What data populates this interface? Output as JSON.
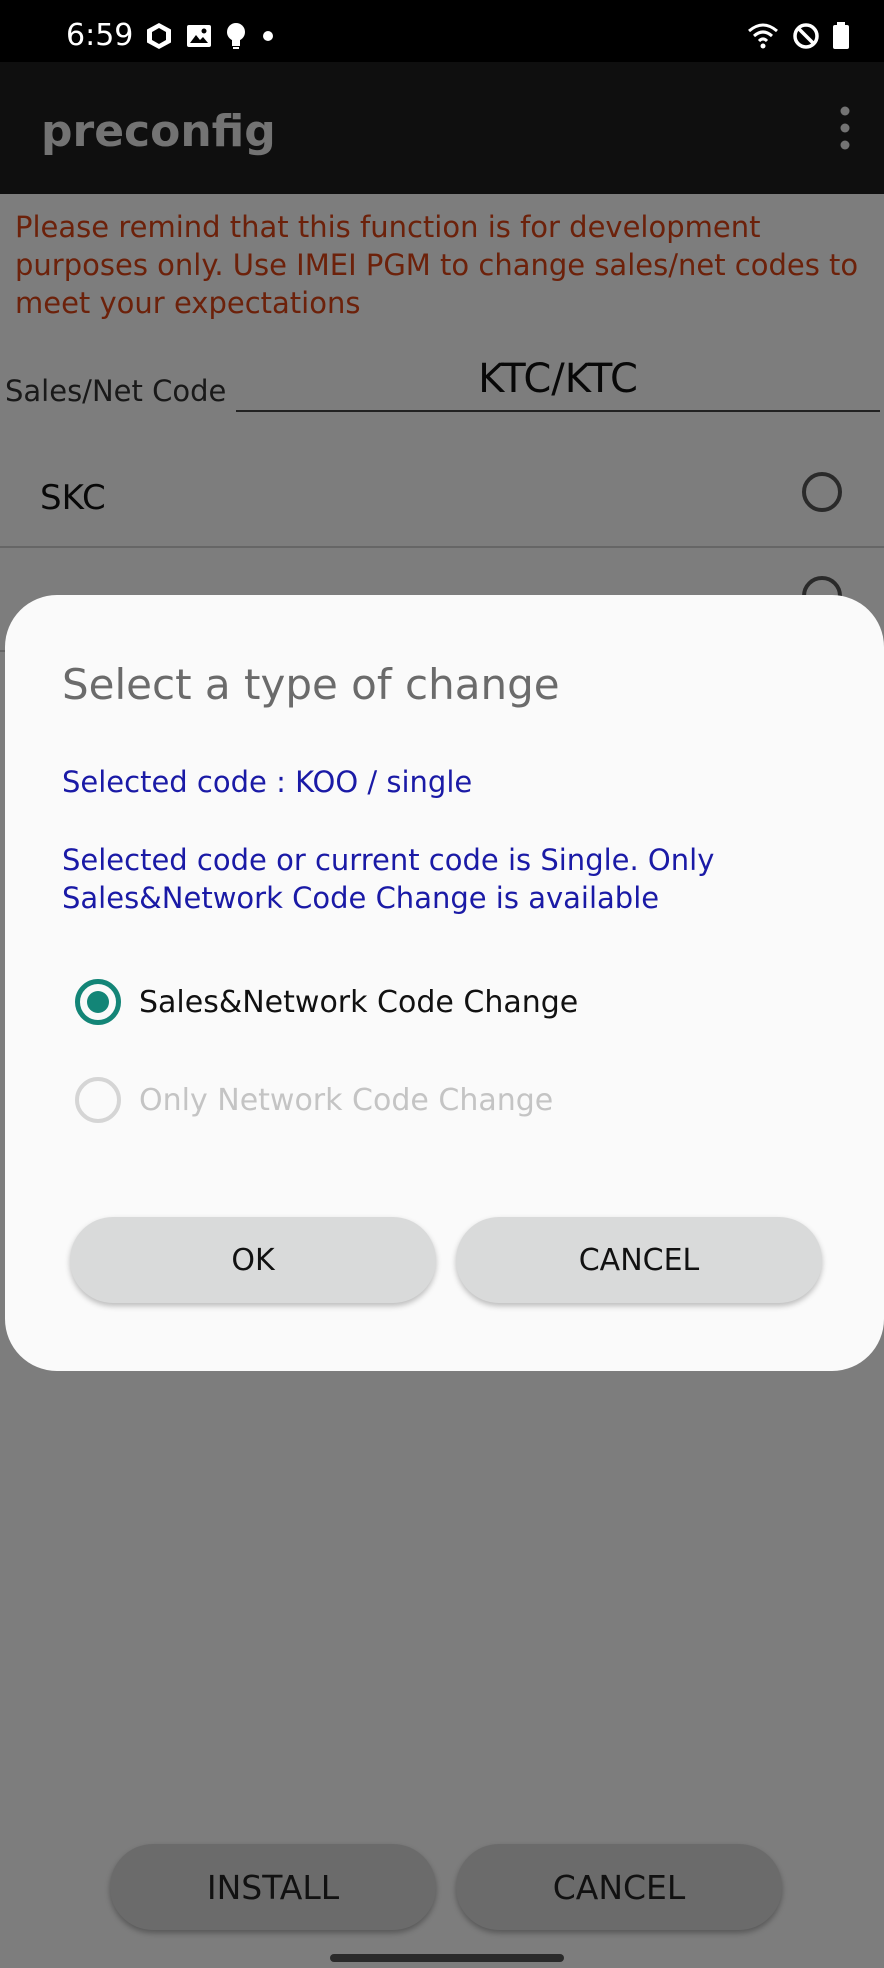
{
  "status_bar": {
    "time": "6:59",
    "left_icons": [
      "cube-icon",
      "image-icon",
      "bulb-icon",
      "dot-icon"
    ],
    "right_icons": [
      "wifi-icon",
      "do-not-disturb-icon",
      "battery-icon"
    ]
  },
  "app_bar": {
    "title": "preconfig",
    "menu_icon": "more-vert-icon"
  },
  "main": {
    "warning": "Please remind that this function is for development purposes only. Use IMEI PGM to change sales/net codes to meet your expectations",
    "code_label": "Sales/Net Code",
    "code_value": "KTC/KTC",
    "list_items": [
      {
        "label": "SKC"
      }
    ],
    "install_button": "INSTALL",
    "cancel_button": "CANCEL"
  },
  "dialog": {
    "title": "Select a type of change",
    "selected_code": "Selected code : KOO / single",
    "message": "Selected code or current code is Single. Only Sales&Network Code Change is available",
    "options": [
      {
        "label": "Sales&Network Code Change",
        "checked": true,
        "enabled": true
      },
      {
        "label": "Only Network Code Change",
        "checked": false,
        "enabled": false
      }
    ],
    "ok_button": "OK",
    "cancel_button": "CANCEL"
  },
  "colors": {
    "warning": "#d84315",
    "dialog_text": "#1a1aa6",
    "radio_accent": "#138577",
    "app_bar": "#1e1e1e"
  }
}
